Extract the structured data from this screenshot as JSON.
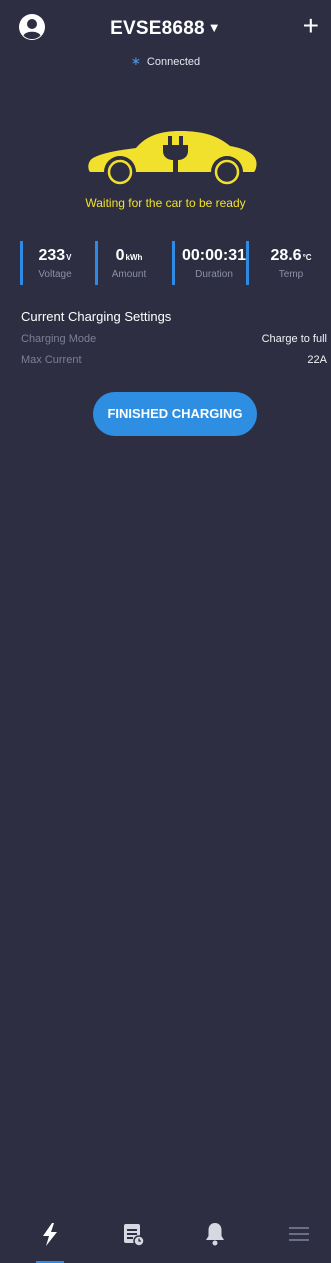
{
  "header": {
    "device_name": "EVSE8688",
    "caret": "▼",
    "add_label": "+",
    "connection_status": "Connected",
    "bluetooth_icon": "bluetooth-icon"
  },
  "car": {
    "icon": "ev-car-plug-icon",
    "color": "#f2e12c",
    "status_text": "Waiting for the car to be ready"
  },
  "stats": [
    {
      "value": "233",
      "unit": "V",
      "label": "Voltage"
    },
    {
      "value": "0",
      "unit": "kWh",
      "label": "Amount"
    },
    {
      "value": "00:00:31",
      "unit": "",
      "label": "Duration"
    },
    {
      "value": "28.6",
      "unit": "°C",
      "label": "Temp"
    }
  ],
  "settings": {
    "title": "Current Charging Settings",
    "rows": [
      {
        "key": "Charging Mode",
        "value": "Charge to full"
      },
      {
        "key": "Max Current",
        "value": "22A"
      }
    ]
  },
  "action": {
    "label": "FINISHED CHARGING",
    "color": "#2e8fe2"
  },
  "tabbar": {
    "items": [
      {
        "icon": "lightning-icon",
        "active": true
      },
      {
        "icon": "records-icon",
        "active": false
      },
      {
        "icon": "bell-icon",
        "active": false
      },
      {
        "icon": "menu-icon",
        "active": false
      }
    ],
    "accent": "#2f8ae4"
  }
}
